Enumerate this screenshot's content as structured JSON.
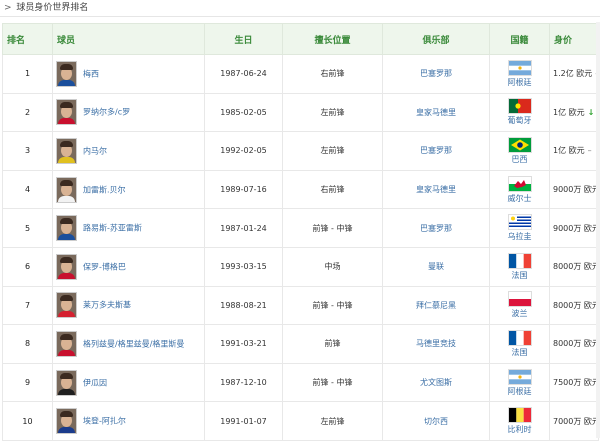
{
  "breadcrumb": {
    "prefix": ">",
    "title": "球员身价世界排名"
  },
  "headers": {
    "rank": "排名",
    "player": "球员",
    "birthday": "生日",
    "position": "擅长位置",
    "club": "俱乐部",
    "country": "国籍",
    "value": "身价"
  },
  "colors": {
    "header_bg": "#eef6ec",
    "header_text": "#3a8a3a",
    "link": "#3a6ea5",
    "trend_down": "#2aa02a",
    "trend_up": "#e27b2b"
  },
  "rows": [
    {
      "rank": "1",
      "name": "梅西",
      "birthday": "1987-06-24",
      "position": "右前锋",
      "club": "巴塞罗那",
      "country": "阿根廷",
      "flag": "argentina",
      "value": "1.2亿 欧元",
      "trend": "–",
      "trend_kind": "flat"
    },
    {
      "rank": "2",
      "name": "罗纳尔多/c罗",
      "birthday": "1985-02-05",
      "position": "左前锋",
      "club": "皇家马德里",
      "country": "葡萄牙",
      "flag": "portugal",
      "value": "1亿 欧元",
      "trend": "↓",
      "trend_kind": "down"
    },
    {
      "rank": "3",
      "name": "内马尔",
      "birthday": "1992-02-05",
      "position": "左前锋",
      "club": "巴塞罗那",
      "country": "巴西",
      "flag": "brazil",
      "value": "1亿 欧元",
      "trend": "–",
      "trend_kind": "flat"
    },
    {
      "rank": "4",
      "name": "加雷斯.贝尔",
      "birthday": "1989-07-16",
      "position": "右前锋",
      "club": "皇家马德里",
      "country": "威尔士",
      "flag": "wales",
      "value": "9000万 欧元",
      "trend": "–",
      "trend_kind": "flat"
    },
    {
      "rank": "5",
      "name": "路易斯-苏亚雷斯",
      "birthday": "1987-01-24",
      "position": "前锋 - 中锋",
      "club": "巴塞罗那",
      "country": "乌拉圭",
      "flag": "uruguay",
      "value": "9000万 欧元",
      "trend": "–",
      "trend_kind": "flat"
    },
    {
      "rank": "6",
      "name": "保罗-博格巴",
      "birthday": "1993-03-15",
      "position": "中场",
      "club": "曼联",
      "country": "法国",
      "flag": "france",
      "value": "8000万 欧元",
      "trend": "–",
      "trend_kind": "flat"
    },
    {
      "rank": "7",
      "name": "莱万多夫斯基",
      "birthday": "1988-08-21",
      "position": "前锋 - 中锋",
      "club": "拜仁慕尼黑",
      "country": "波兰",
      "flag": "poland",
      "value": "8000万 欧元",
      "trend": "↑",
      "trend_kind": "up"
    },
    {
      "rank": "8",
      "name": "格列兹曼/格里兹曼/格里斯曼",
      "birthday": "1991-03-21",
      "position": "前锋",
      "club": "马德里竞技",
      "country": "法国",
      "flag": "france",
      "value": "8000万 欧元",
      "trend": "–",
      "trend_kind": "flat"
    },
    {
      "rank": "9",
      "name": "伊瓜因",
      "birthday": "1987-12-10",
      "position": "前锋 - 中锋",
      "club": "尤文图斯",
      "country": "阿根廷",
      "flag": "argentina",
      "value": "7500万 欧元",
      "trend": "–",
      "trend_kind": "flat"
    },
    {
      "rank": "10",
      "name": "埃登-阿扎尔",
      "birthday": "1991-01-07",
      "position": "左前锋",
      "club": "切尔西",
      "country": "比利时",
      "flag": "belgium",
      "value": "7000万 欧元",
      "trend": "↑",
      "trend_kind": "up"
    }
  ]
}
